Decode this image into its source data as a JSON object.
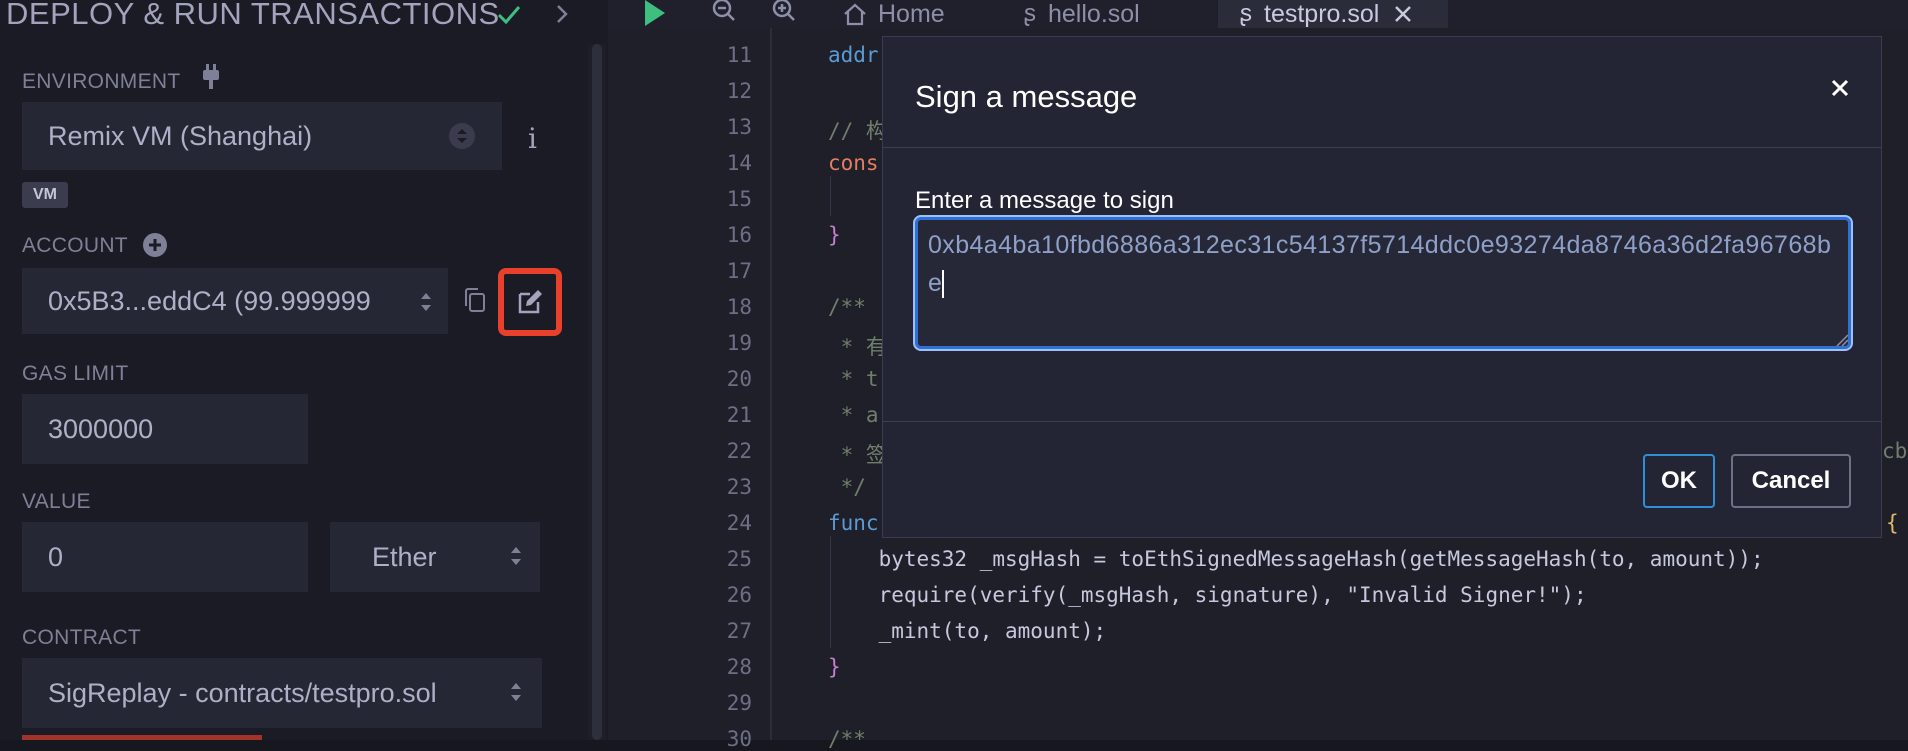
{
  "left_panel": {
    "title": "DEPLOY & RUN TRANSACTIONS",
    "environment_label": "ENVIRONMENT",
    "environment_value": "Remix VM (Shanghai)",
    "vm_badge": "VM",
    "account_label": "ACCOUNT",
    "account_value": "0x5B3...eddC4 (99.999999",
    "gas_limit_label": "GAS LIMIT",
    "gas_limit_value": "3000000",
    "value_label": "VALUE",
    "value_amount": "0",
    "value_unit": "Ether",
    "contract_label": "CONTRACT",
    "contract_value": "SigReplay - contracts/testpro.sol"
  },
  "tabs": [
    {
      "label": "Home",
      "icon": "home-icon"
    },
    {
      "label": "hello.sol",
      "icon": "solidity-icon"
    },
    {
      "label": "testpro.sol",
      "icon": "solidity-icon"
    }
  ],
  "editor": {
    "lines": [
      {
        "n": "11",
        "text": "addr"
      },
      {
        "n": "12",
        "text": ""
      },
      {
        "n": "13",
        "text": "// 构"
      },
      {
        "n": "14",
        "text": "cons"
      },
      {
        "n": "15",
        "text": ""
      },
      {
        "n": "16",
        "text": "}"
      },
      {
        "n": "17",
        "text": ""
      },
      {
        "n": "18",
        "text": "/**"
      },
      {
        "n": "19",
        "text": " * 有"
      },
      {
        "n": "20",
        "text": " * t"
      },
      {
        "n": "21",
        "text": " * a"
      },
      {
        "n": "22",
        "text": " * 签"
      },
      {
        "n": "23",
        "text": " */"
      },
      {
        "n": "24",
        "text": "func"
      },
      {
        "n": "25",
        "text": "    bytes32 _msgHash = toEthSignedMessageHash(getMessageHash(to, amount));"
      },
      {
        "n": "26",
        "text": "    require(verify(_msgHash, signature), \"Invalid Signer!\");"
      },
      {
        "n": "27",
        "text": "    _mint(to, amount);"
      },
      {
        "n": "28",
        "text": "}"
      },
      {
        "n": "29",
        "text": ""
      },
      {
        "n": "30",
        "text": "/**"
      }
    ],
    "line22_tail": "cb",
    "line24_tail": "{"
  },
  "modal": {
    "title": "Sign a message",
    "label": "Enter a message to sign",
    "message": "0xb4a4ba10fbd6886a312ec31c54137f5714ddc0e93274da8746a36d2fa96768be",
    "ok_label": "OK",
    "cancel_label": "Cancel"
  },
  "colors": {
    "highlight_box": "#e8402a",
    "focus_border": "#2f6fd6",
    "check": "#3fbf7f"
  }
}
